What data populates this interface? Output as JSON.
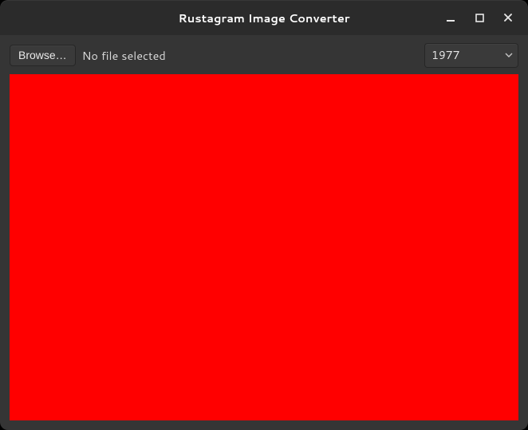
{
  "window": {
    "title": "Rustagram Image Converter"
  },
  "toolbar": {
    "browse_label": "Browse…",
    "status_text": "No file selected",
    "filter_selected": "1977"
  },
  "preview": {
    "fill_color": "#ff0000"
  }
}
